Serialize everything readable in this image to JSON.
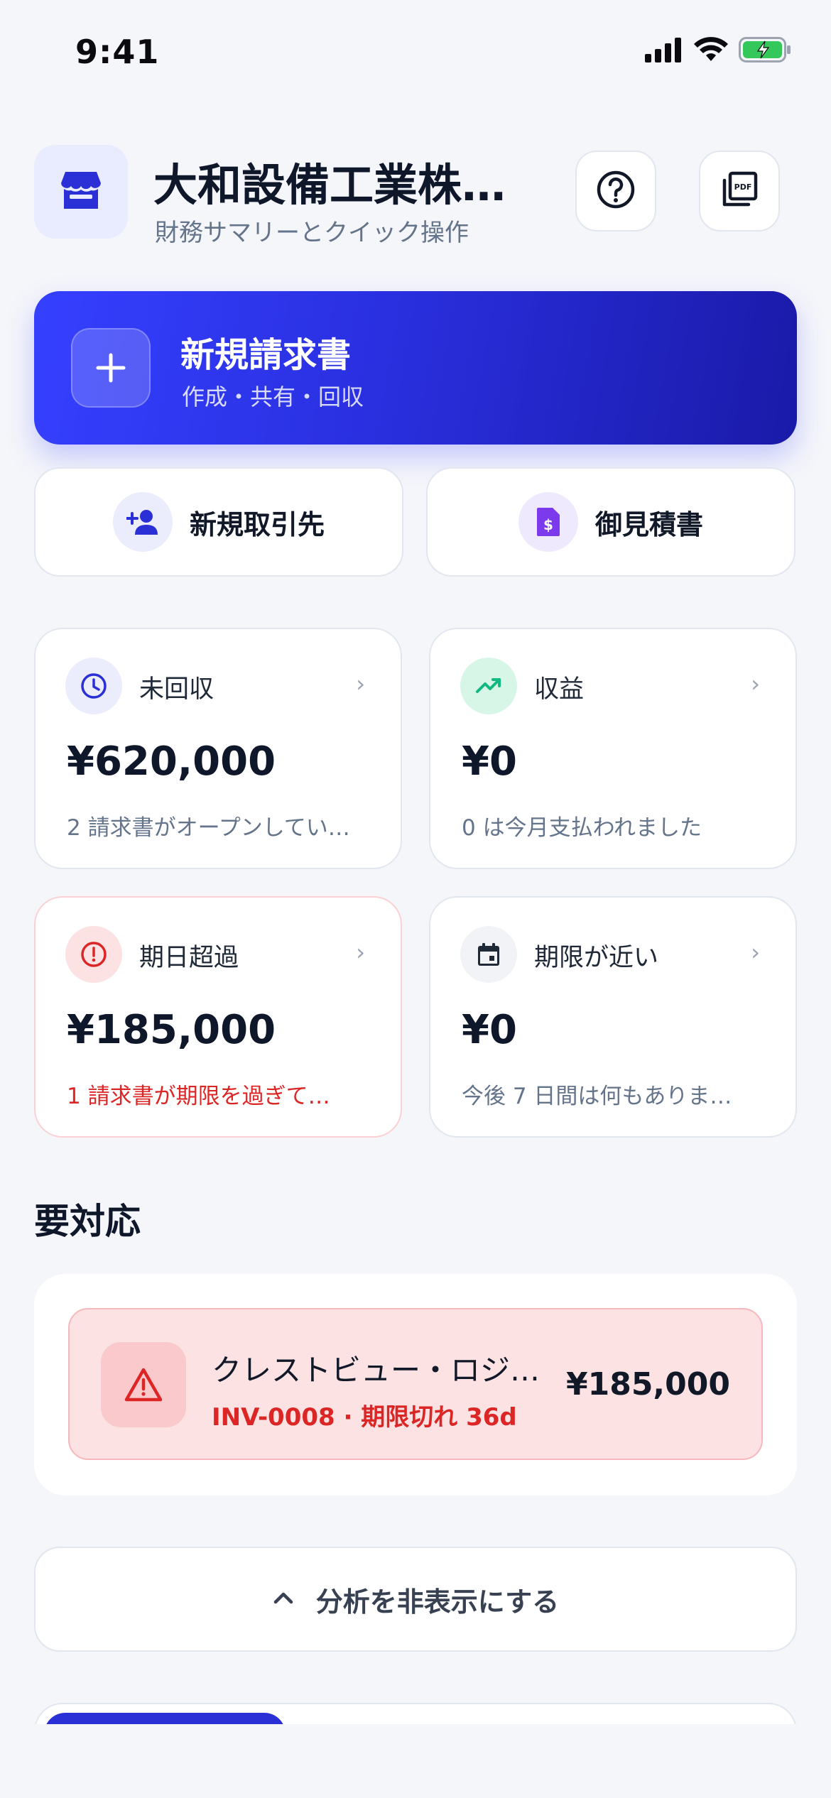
{
  "status_bar": {
    "time": "9:41",
    "icons": [
      "signal-icon",
      "wifi-icon",
      "battery-charging-icon"
    ]
  },
  "header": {
    "company_name": "大和設備工業株…",
    "subtitle": "財務サマリーとクイック操作",
    "icons": [
      "store-icon",
      "help-icon",
      "pdf-icon"
    ]
  },
  "hero": {
    "title": "新規請求書",
    "subtitle": "作成・共有・回収"
  },
  "quick_actions": [
    {
      "label": "新規取引先",
      "icon": "add-person-icon"
    },
    {
      "label": "御見積書",
      "icon": "quote-document-icon"
    }
  ],
  "stats": [
    {
      "label": "未回収",
      "value": "¥620,000",
      "note": "2 請求書がオープンしてい…",
      "icon": "clock-icon"
    },
    {
      "label": "収益",
      "value": "¥0",
      "note": "0 は今月支払われました",
      "icon": "trending-up-icon"
    },
    {
      "label": "期日超過",
      "value": "¥185,000",
      "note": "1 請求書が期限を過ぎて…",
      "icon": "alert-circle-icon"
    },
    {
      "label": "期限が近い",
      "value": "¥0",
      "note": "今後 7 日間は何もありま…",
      "icon": "calendar-icon"
    }
  ],
  "section": {
    "title": "要対応"
  },
  "action_items": [
    {
      "name": "クレストビュー・ロジ…",
      "meta": "INV-0008 · 期限切れ 36d",
      "amount": "¥185,000",
      "icon": "warning-icon"
    }
  ],
  "toggle": {
    "label": "分析を非表示にする",
    "icon": "chevron-up-icon"
  },
  "colors": {
    "accent": "#2a30e0",
    "background": "#f5f6fa",
    "danger": "#dc2626",
    "success": "#10b981",
    "purple": "#7c3aed"
  }
}
